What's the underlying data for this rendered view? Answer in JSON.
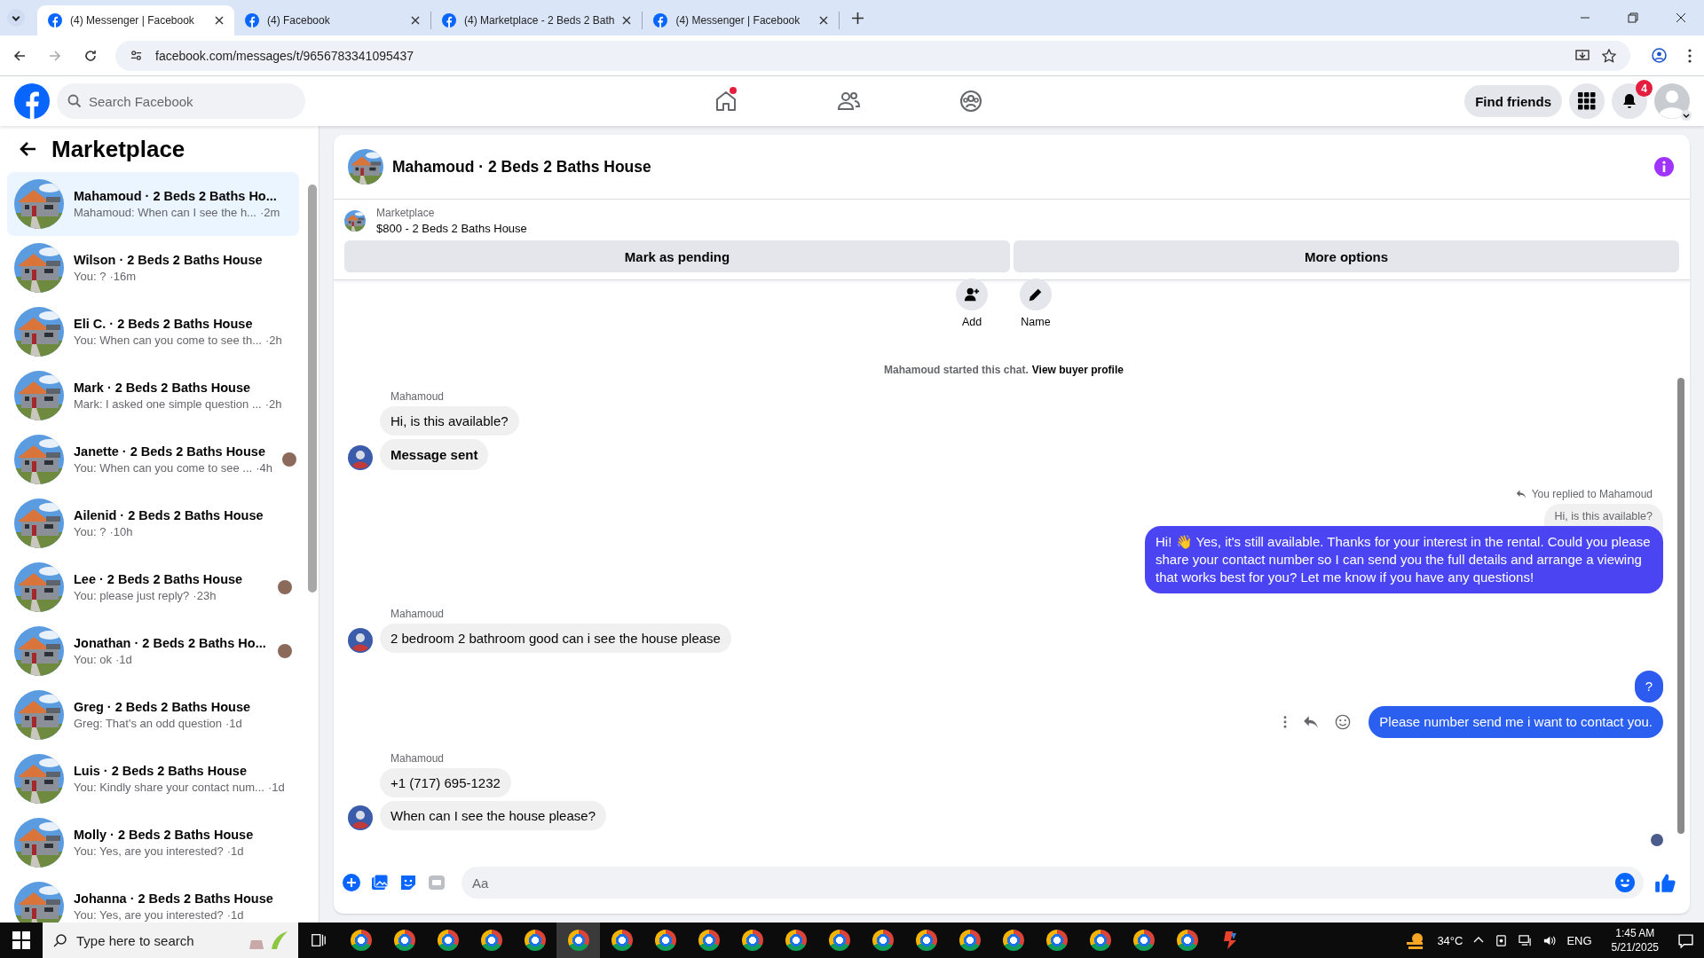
{
  "browser": {
    "tabs": [
      {
        "title": "(4) Messenger | Facebook",
        "selected": true
      },
      {
        "title": "(4) Facebook",
        "selected": false
      },
      {
        "title": "(4) Marketplace - 2 Beds 2 Bath",
        "selected": false
      },
      {
        "title": "(4) Messenger | Facebook",
        "selected": false
      }
    ],
    "url": "facebook.com/messages/t/9656783341095437"
  },
  "header": {
    "search_placeholder": "Search Facebook",
    "nav": [
      {
        "kind": "home",
        "dot": true
      },
      {
        "kind": "friends",
        "dot": false
      },
      {
        "kind": "groups",
        "dot": false
      }
    ],
    "find_friends": "Find friends",
    "notification_count": "4"
  },
  "sidebar": {
    "title": "Marketplace",
    "conversations": [
      {
        "title": "Mahamoud · 2 Beds 2 Baths Ho...",
        "preview": "Mahamoud: When can I see the h...",
        "time": "·2m",
        "selected": true,
        "seen": false
      },
      {
        "title": "Wilson · 2 Beds 2 Baths House",
        "preview": "You: ?",
        "time": "·16m",
        "selected": false,
        "seen": false
      },
      {
        "title": "Eli C. · 2 Beds 2 Baths House",
        "preview": "You: When can you come to see th...",
        "time": "·2h",
        "selected": false,
        "seen": false
      },
      {
        "title": "Mark · 2 Beds 2 Baths House",
        "preview": "Mark: I asked one simple question ...",
        "time": "·2h",
        "selected": false,
        "seen": false
      },
      {
        "title": "Janette · 2 Beds 2 Baths House",
        "preview": "You: When can you come to see ...",
        "time": "·4h",
        "selected": false,
        "seen": true
      },
      {
        "title": "Ailenid · 2 Beds 2 Baths House",
        "preview": "You: ?",
        "time": "·10h",
        "selected": false,
        "seen": false
      },
      {
        "title": "Lee · 2 Beds 2 Baths House",
        "preview": "You: please just reply?",
        "time": "·23h",
        "selected": false,
        "seen": true
      },
      {
        "title": "Jonathan · 2 Beds 2 Baths Ho...",
        "preview": "You: ok",
        "time": "·1d",
        "selected": false,
        "seen": true
      },
      {
        "title": "Greg · 2 Beds 2 Baths House",
        "preview": "Greg: That's an odd question",
        "time": "·1d",
        "selected": false,
        "seen": false
      },
      {
        "title": "Luis · 2 Beds 2 Baths House",
        "preview": "You: Kindly share your contact num...",
        "time": "·1d",
        "selected": false,
        "seen": false
      },
      {
        "title": "Molly · 2 Beds 2 Baths House",
        "preview": "You: Yes, are you interested?",
        "time": "·1d",
        "selected": false,
        "seen": false
      },
      {
        "title": "Johanna · 2 Beds 2 Baths House",
        "preview": "You: Yes, are you interested?",
        "time": "·1d",
        "selected": false,
        "seen": false
      }
    ]
  },
  "chat": {
    "title": "Mahamoud · 2 Beds 2 Baths House",
    "listing": {
      "label": "Marketplace",
      "title": "$800 - 2 Beds 2 Baths House"
    },
    "buttons": [
      "Mark as pending",
      "More options"
    ],
    "actions": [
      {
        "kind": "add",
        "label": "Add"
      },
      {
        "kind": "name",
        "label": "Name"
      }
    ],
    "started": {
      "text": "Mahamoud started this chat.",
      "link": "View buyer profile"
    },
    "messages": [
      {
        "kind": "incoming",
        "sender": "Mahamoud",
        "bubbles": [
          {
            "text": "Hi, is this available?",
            "bold": false
          },
          {
            "text": "Message sent",
            "bold": true
          }
        ]
      },
      {
        "kind": "outgoing",
        "reply_note": "You replied to Mahamoud",
        "quoted": "Hi, is this available?",
        "hovered": false,
        "bubbles": [
          {
            "text": "Hi! 👋 Yes, it's still available. Thanks for your interest in the rental. Could you please share your contact number so I can send you the full details and arrange a viewing that works best for you? Let me know if you have any questions!",
            "color": "#4a44f2"
          }
        ]
      },
      {
        "kind": "incoming",
        "sender": "Mahamoud",
        "bubbles": [
          {
            "text": "2 bedroom 2 bathroom good can i see the house please",
            "bold": false
          }
        ]
      },
      {
        "kind": "outgoing",
        "hovered": true,
        "bubbles": [
          {
            "text": "?",
            "color": "#2d5bef"
          },
          {
            "text": "Please number send me i want to contact you.",
            "color": "#2a5ff0"
          }
        ]
      },
      {
        "kind": "incoming",
        "sender": "Mahamoud",
        "bubbles": [
          {
            "text": "+1 (717) 695-1232",
            "bold": false
          },
          {
            "text": "When can I see the house please?",
            "bold": false
          }
        ]
      }
    ],
    "composer_placeholder": "Aa"
  },
  "taskbar": {
    "search_placeholder": "Type here to search",
    "apps": [
      {
        "kind": "chrome",
        "selected": false
      },
      {
        "kind": "chrome",
        "selected": false
      },
      {
        "kind": "chrome",
        "selected": false
      },
      {
        "kind": "chrome",
        "selected": false
      },
      {
        "kind": "chrome",
        "selected": false
      },
      {
        "kind": "chrome",
        "selected": true
      },
      {
        "kind": "chrome",
        "selected": false
      },
      {
        "kind": "chrome",
        "selected": false
      },
      {
        "kind": "chrome",
        "selected": false
      },
      {
        "kind": "chrome",
        "selected": false
      },
      {
        "kind": "chrome",
        "selected": false
      },
      {
        "kind": "chrome",
        "selected": false
      },
      {
        "kind": "chrome",
        "selected": false
      },
      {
        "kind": "chrome",
        "selected": false
      },
      {
        "kind": "chrome",
        "selected": false
      },
      {
        "kind": "chrome",
        "selected": false
      },
      {
        "kind": "chrome",
        "selected": false
      },
      {
        "kind": "chrome",
        "selected": false
      },
      {
        "kind": "chrome",
        "selected": false
      },
      {
        "kind": "chrome",
        "selected": false
      },
      {
        "kind": "other",
        "selected": false
      }
    ],
    "temperature": "34°C",
    "language": "ENG",
    "time": "1:45 AM",
    "date": "5/21/2025"
  }
}
